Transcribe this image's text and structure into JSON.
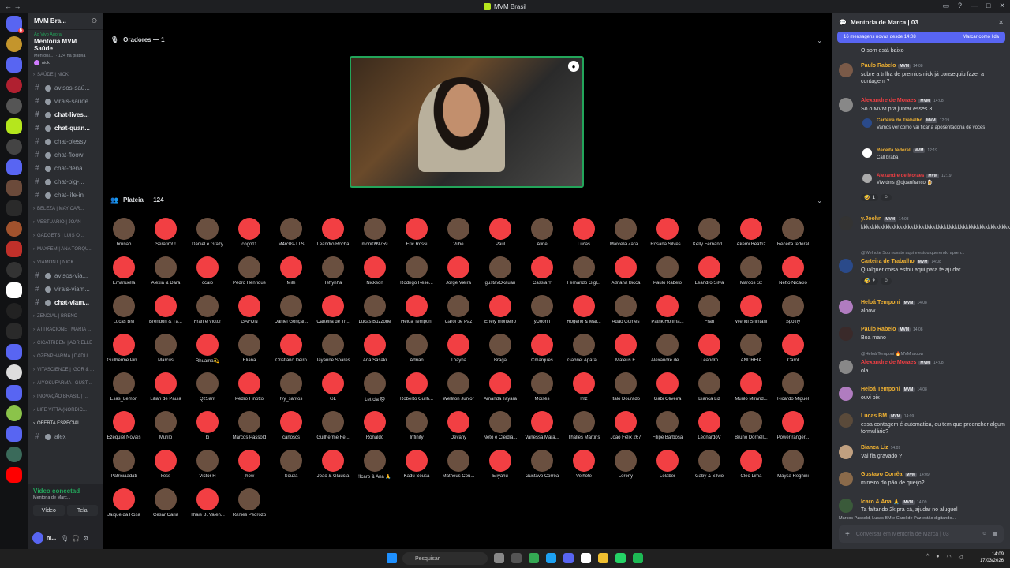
{
  "window": {
    "title": "MVM Brasil"
  },
  "channels": {
    "guild_name": "MVM Bra...",
    "live_label": "Ao Vivo Agora",
    "event_title": "Mentoria MVM Saúde",
    "event_sub": "Mentoria... · 124 na plateia",
    "event_user": "nick",
    "rows": [
      {
        "type": "cat",
        "label": "SAÚDE | Nick"
      },
      {
        "type": "ch",
        "label": "avisos-saú..."
      },
      {
        "type": "ch",
        "label": "virais-saúde"
      },
      {
        "type": "ch",
        "label": "chat-lives...",
        "bold": true
      },
      {
        "type": "ch",
        "label": "chat-quan...",
        "bold": true
      },
      {
        "type": "ch",
        "label": "chat-blessy"
      },
      {
        "type": "ch",
        "label": "chat-floow"
      },
      {
        "type": "ch",
        "label": "chat-dena..."
      },
      {
        "type": "ch",
        "label": "chat-big-..."
      },
      {
        "type": "ch",
        "label": "chat-life-in"
      },
      {
        "type": "cat",
        "label": "BELEZA | May Car..."
      },
      {
        "type": "cat",
        "label": "VESTUÁRIO | Joan"
      },
      {
        "type": "cat",
        "label": "GADGETS | Luis O..."
      },
      {
        "type": "cat",
        "label": "MAXFEM | Ana Torqu..."
      },
      {
        "type": "cat",
        "label": "VIAMONT | Nick"
      },
      {
        "type": "ch",
        "label": "avisos-via..."
      },
      {
        "type": "ch",
        "label": "virais-viam..."
      },
      {
        "type": "ch",
        "label": "chat-viam...",
        "bold": true
      },
      {
        "type": "cat",
        "label": "ZENCIAL | Breno"
      },
      {
        "type": "cat",
        "label": "ATTRACIONE | Maria ..."
      },
      {
        "type": "cat",
        "label": "CICATRIBEM | Adrielle"
      },
      {
        "type": "cat",
        "label": "OZENPHARMA | Dadu"
      },
      {
        "type": "cat",
        "label": "VITASCIENCE | Igor & ..."
      },
      {
        "type": "cat",
        "label": "AIYOKUFARMA | Gust..."
      },
      {
        "type": "cat",
        "label": "INOVAÇÃO BRASIL | ..."
      },
      {
        "type": "cat",
        "label": "LIFE VITTA (NORDIC..."
      },
      {
        "type": "cat",
        "label": "OFERTA ESPECIAL",
        "bold": true
      },
      {
        "type": "ch",
        "label": "alex"
      }
    ],
    "voice": {
      "status": "Vídeo conectad",
      "sub": "Mentoria de Marc...",
      "video_btn": "Vídeo",
      "screen_btn": "Tela"
    },
    "user": {
      "name": "ni..."
    }
  },
  "stage": {
    "speakers_label": "Oradores — 1",
    "audience_label": "Plateia — 124",
    "audience": [
      "brunão",
      "Serafim!!!",
      "Daniel e Grazy",
      "cogo11",
      "M4rc0s-TTS",
      "Leandro Rocha",
      "moni099759",
      "Eric Rossi",
      "Vilbe",
      "Paul",
      "Aline",
      "Lucas",
      "Marcela Zara...",
      "Rosana Silves...",
      "Kelly Fernand...",
      "Akemi Beatriz",
      "Receita federal",
      "Emanuella",
      "Alexia & Dara",
      "ccaio",
      "Pedro Henrique",
      "Milh",
      "Teffynha",
      "Nickson",
      "Rodrigo Rese...",
      "Jorge Vieira",
      "gustavOkauan",
      "Cassia Y",
      "Fernando Gigl...",
      "Adriana Bicca",
      "Paulo Rabelo",
      "Leandro Silva",
      "Marcos Sz",
      "Netto Nicacio",
      "Lucas BM",
      "Brendon & Tâ...",
      "Fran e Victor",
      "GAFON",
      "Daniel Gonçal...",
      "Carteira de Tr...",
      "Lucas Buzzone",
      "Heloá Temponi",
      "Carol de Paz",
      "Enely monteiro",
      "y.Joohn",
      "Rogério & Mar...",
      "Adão Gomes",
      "Patrik Hoffma...",
      "Fran",
      "Wendi Shintani",
      "Spotify",
      "Guilherme Pin...",
      "Marcus",
      "Rhuama💫",
      "Eliana",
      "Cristiano Deiro",
      "Jayanne Soares",
      "Ana Sasaki",
      "Adrian",
      "Thayna",
      "Braga",
      "Cmarques",
      "Gabriel Apara...",
      "Mateus F.",
      "Alexandre de ...",
      "Leandro",
      "ANDREIA",
      "Carol",
      "Elias_Lemon",
      "Lilian de Paula",
      "QzSant",
      "Pedro Finotto",
      "Ivy_santos",
      "GL",
      "Letícia 🐱",
      "Roberto Guilh...",
      "Welliton Junior",
      "Amanda Tayara",
      "Moisés",
      "lmz",
      "Italo Dourado",
      "Gabi Oliveira",
      "Bianca Liz",
      "Murilo Mirand...",
      "Ricardo Miguel",
      "Ezequiel Novais",
      "Murilo",
      "bi",
      "Marcos Passold",
      "carloscs",
      "Guilherme Fe...",
      "Ronaldo",
      "Infinity",
      "Devany",
      "Neto e Cleidia...",
      "Vanessa Mara...",
      "Thalles Martins",
      "João Felix 267",
      "Filipe Barbosa",
      "LeonardoV",
      "Bruno Dornell...",
      "Power ranger...",
      "Patriciaadati",
      "kess",
      "Victor H",
      "jhow",
      "Souza",
      "João & Glaucia",
      "!Icaro & Ana 🙏",
      "Kadu Sousa",
      "Matheus Cou...",
      "Eliyahu",
      "Gustavo Corrêa",
      "Velhote",
      "Loreny",
      "Lelaber",
      "Gaby & Silvio",
      "Cleo Lima",
      "Maysa Reghini",
      "Jaique da Rosa",
      "Cesar Caria",
      "Thais B. Valen...",
      "Ranieli Pedrozo"
    ]
  },
  "chat": {
    "title": "Mentoria de Marca | 03",
    "new_messages": "16 mensagens novas desde 14:08",
    "mark_read": "Marcar como lida",
    "messages": [
      {
        "author": "",
        "time": "",
        "text": "O som está baixo",
        "color": "#dbdee1"
      },
      {
        "author": "Paulo Rabelo",
        "tag": "MVM",
        "time": "14:08",
        "text": "sobre a trilha de premios nick já conseguiu fazer a contagem ?",
        "color": "#f0b232"
      },
      {
        "author": "Alexandre de Moraes",
        "tag": "MVM",
        "time": "14:08",
        "text": "So o MVM pra juntar esses 3",
        "color": "#f23f43"
      },
      {
        "author": "Carteira de Trabalho",
        "tag": "MVM",
        "time": "12:19",
        "text": "Vamos ver como vai ficar a aposentadoria de voces",
        "color": "#f0b232"
      },
      {
        "author": "Receita federal",
        "tag": "MVM",
        "time": "12:19",
        "text": "Call braba",
        "color": "#f0b232"
      },
      {
        "author": "Alexandre de Moraes",
        "tag": "MVM",
        "time": "12:19",
        "text": "Vlw dms @ojoanfranco 🍺",
        "color": "#f23f43"
      },
      {
        "author": "y.Joohn",
        "tag": "MVM",
        "time": "14:08",
        "text": "kkkkkkkkkkkkkkkkkkkkkkkkkkkkkkkkkkkkkkkkkkkkkkkkkkkkkkk",
        "color": "#f0b232"
      },
      {
        "author": "Carteira de Trabalho",
        "tag": "MVM",
        "time": "14:08",
        "text": "Qualquer coisa estou aqui para te ajudar !",
        "color": "#f0b232"
      },
      {
        "author": "Heloá Temponi",
        "tag": "MVM",
        "time": "14:08",
        "text": "aloow",
        "color": "#f0b232"
      },
      {
        "author": "Paulo Rabelo",
        "tag": "MVM",
        "time": "14:08",
        "text": "Boa mano",
        "color": "#f0b232"
      },
      {
        "author": "Alexandre de Moraes",
        "tag": "MVM",
        "time": "14:08",
        "text": "ola",
        "color": "#f23f43"
      },
      {
        "author": "Heloá Temponi",
        "tag": "MVM",
        "time": "14:08",
        "text": "ouvi pix",
        "color": "#f0b232"
      },
      {
        "author": "Lucas BM",
        "tag": "MVM",
        "time": "14:09",
        "text": "essa contagem é automatica, ou tem que preencher algum formulário?",
        "color": "#f0b232"
      },
      {
        "author": "Bianca Liz",
        "tag": "",
        "time": "14:09",
        "text": "Vai fia gravado ?",
        "color": "#f0b232"
      },
      {
        "author": "Gustavo Corrêa",
        "tag": "MVM",
        "time": "14:09",
        "text": "mineiro do pão de queijo?",
        "color": "#f0b232"
      },
      {
        "author": "Icaro & Ana 🙏",
        "tag": "MVM",
        "time": "14:09",
        "text": "Ta faltando 2k pra cá, ajudar no aluguel",
        "color": "#f0b232"
      }
    ],
    "replies": [
      "@Welhote Sou novato aqui e estou querendo apren...",
      "@Heloá Temponi 🔥MVM aloow"
    ],
    "reactions": [
      {
        "emoji": "🤣",
        "count": "1"
      },
      {
        "emoji": "🤣",
        "count": "2"
      }
    ],
    "typing": "Marcos Passold, Lucas BM e Carol de Paz estão digitando...",
    "input_placeholder": "Conversar em Mentoria de Marca | 03"
  },
  "taskbar": {
    "search": "Pesquisar",
    "time": "14:09",
    "date": "17/03/2026"
  },
  "colors": {
    "accent": "#5865f2",
    "online": "#23a55a",
    "bg": "#000000",
    "panel": "#2b2d31",
    "chat": "#313338"
  }
}
